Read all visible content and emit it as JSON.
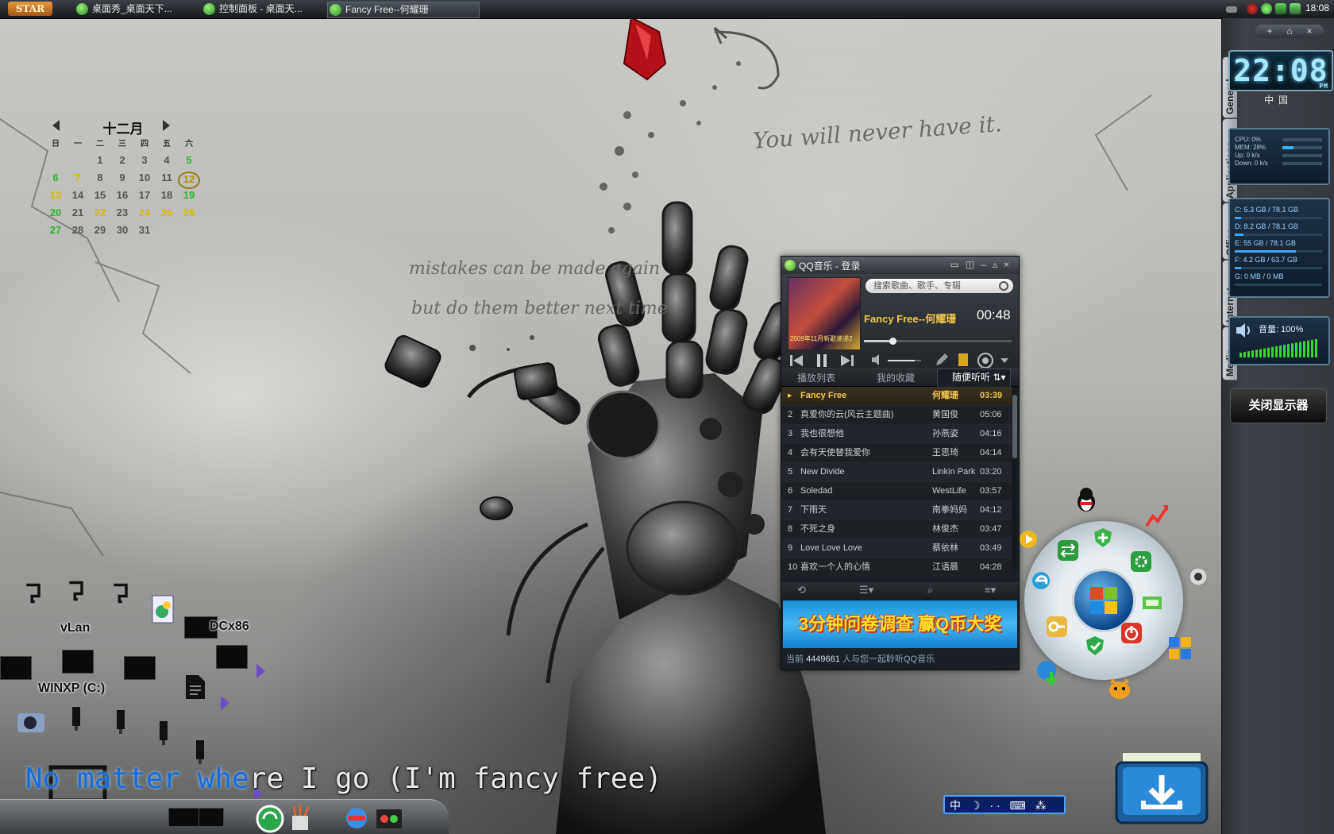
{
  "taskbar": {
    "start_label": "STAR",
    "tasks": [
      {
        "label": "桌面秀_桌面天下..."
      },
      {
        "label": "控制面板 - 桌面天..."
      },
      {
        "label": "Fancy Free--何耀珊"
      }
    ],
    "clock": "18:08"
  },
  "calendar": {
    "month": "十二月",
    "weekdays": [
      "日",
      "一",
      "二",
      "三",
      "四",
      "五",
      "六"
    ],
    "today": "12"
  },
  "wallpaper": {
    "script_top": "You will never have it.",
    "script_1": "mistakes can be made again",
    "script_2": "but do them better next time"
  },
  "desktop_icons": {
    "vlan": "vLan",
    "dcx86": "DCx86",
    "winxp": "WINXP (C:)"
  },
  "lyric": {
    "highlight": "No matter whe",
    "rest": "re I go (I'm fancy free)"
  },
  "qq_music": {
    "title": "QQ音乐 - 登录",
    "search_placeholder": "搜索歌曲、歌手、专辑",
    "now_playing": "Fancy Free--何耀珊",
    "elapsed": "00:48",
    "progress": 0.17,
    "volume_level": 0.8,
    "album_caption": "2009年11月新歌速递2",
    "tabs": [
      "播放列表",
      "我的收藏",
      "随便听听"
    ],
    "playlist": [
      {
        "num": "",
        "title": "Fancy Free",
        "artist": "何耀珊",
        "time": "03:39"
      },
      {
        "num": "2",
        "title": "真爱你的云(风云主题曲)",
        "artist": "黄国俊",
        "time": "05:06"
      },
      {
        "num": "3",
        "title": "我也很想他",
        "artist": "孙燕姿",
        "time": "04:16"
      },
      {
        "num": "4",
        "title": "会有天使替我爱你",
        "artist": "王思琦",
        "time": "04:14"
      },
      {
        "num": "5",
        "title": "New Divide",
        "artist": "Linkin Park",
        "time": "03:20"
      },
      {
        "num": "6",
        "title": "Soledad",
        "artist": "WestLife",
        "time": "03:57"
      },
      {
        "num": "7",
        "title": "下雨天",
        "artist": "南拳妈妈",
        "time": "04:12"
      },
      {
        "num": "8",
        "title": "不死之身",
        "artist": "林俊杰",
        "time": "03:47"
      },
      {
        "num": "9",
        "title": "Love Love Love",
        "artist": "蔡依林",
        "time": "03:49"
      },
      {
        "num": "10",
        "title": "喜欢一个人的心情",
        "artist": "江语晨",
        "time": "04:28"
      }
    ],
    "ad_text": "3分钟问卷调查 赢Q币大奖",
    "footer_prefix": "当前",
    "footer_count": "4449661",
    "footer_suffix": "人与您一起聆听QQ音乐"
  },
  "sidebar": {
    "tabs": [
      "General",
      "Applications",
      "Office",
      "Internet",
      "Media"
    ],
    "controls": [
      "+",
      "⌂",
      "×"
    ],
    "digital_clock": "22:08",
    "digital_clock_suffix": "PM",
    "country": "中国",
    "stats": [
      {
        "label": "CPU: 0%",
        "value": 0
      },
      {
        "label": "MEM: 28%",
        "value": 0.28
      },
      {
        "label": "Up: 0 k/s",
        "value": 0
      },
      {
        "label": "Down: 0 k/s",
        "value": 0
      }
    ],
    "drives": [
      {
        "label": "C: 5.3 GB / 78.1 GB",
        "used": 0.07
      },
      {
        "label": "D: 8.2 GB / 78.1 GB",
        "used": 0.1
      },
      {
        "label": "E: 55 GB / 78.1 GB",
        "used": 0.7
      },
      {
        "label": "F: 4.2 GB / 63.7 GB",
        "used": 0.07
      },
      {
        "label": "G: 0 MB / 0 MB",
        "used": 0
      }
    ],
    "volume_label": "音量:",
    "volume_value": "100%",
    "close_monitor": "关闭显示器"
  },
  "input_bar": "中 ☽ ·· ⌨ ⁂"
}
